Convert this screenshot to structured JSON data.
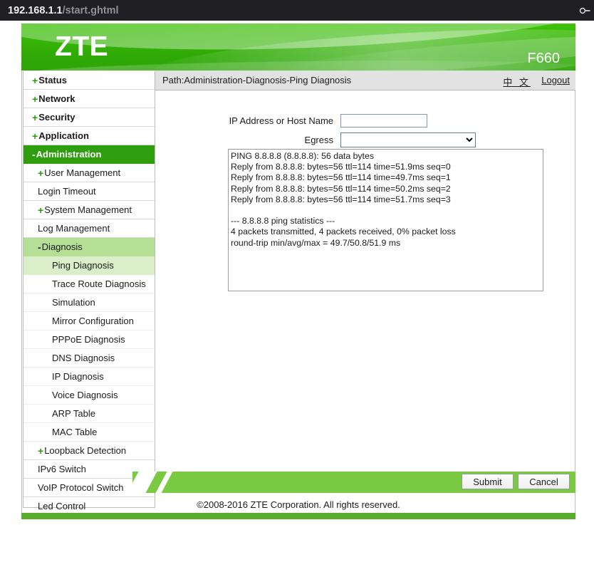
{
  "browser": {
    "url_host": "192.168.1.1",
    "url_path": "/start.ghtml",
    "titlebar_icon": "key-icon"
  },
  "header": {
    "logo": "ZTE",
    "model": "F660",
    "brand_green": "#35b307"
  },
  "pathbar": {
    "path": "Path:Administration-Diagnosis-Ping Diagnosis",
    "lang_link": "中 文",
    "logout_link": "Logout"
  },
  "sidebar": {
    "selected_color": "#2f9e0e",
    "group_color": "#b4df94",
    "active_color": "#d9eec9",
    "items": [
      {
        "label": "Status",
        "level": 1,
        "prefix": "+",
        "state": "collapsed"
      },
      {
        "label": "Network",
        "level": 1,
        "prefix": "+",
        "state": "collapsed"
      },
      {
        "label": "Security",
        "level": 1,
        "prefix": "+",
        "state": "collapsed"
      },
      {
        "label": "Application",
        "level": 1,
        "prefix": "+",
        "state": "collapsed"
      },
      {
        "label": "Administration",
        "level": 1,
        "prefix": "-",
        "state": "selected"
      },
      {
        "label": "User Management",
        "level": 2,
        "prefix": "+",
        "state": "collapsed"
      },
      {
        "label": "Login Timeout",
        "level": 2,
        "prefix": "",
        "state": "normal"
      },
      {
        "label": "System Management",
        "level": 2,
        "prefix": "+",
        "state": "collapsed"
      },
      {
        "label": "Log Management",
        "level": 2,
        "prefix": "",
        "state": "normal"
      },
      {
        "label": "Diagnosis",
        "level": 2,
        "prefix": "-",
        "state": "group-open"
      },
      {
        "label": "Ping Diagnosis",
        "level": 3,
        "prefix": "",
        "state": "active"
      },
      {
        "label": "Trace Route Diagnosis",
        "level": 3,
        "prefix": "",
        "state": "normal"
      },
      {
        "label": "Simulation",
        "level": 3,
        "prefix": "",
        "state": "normal"
      },
      {
        "label": "Mirror Configuration",
        "level": 3,
        "prefix": "",
        "state": "normal"
      },
      {
        "label": "PPPoE Diagnosis",
        "level": 3,
        "prefix": "",
        "state": "normal"
      },
      {
        "label": "DNS Diagnosis",
        "level": 3,
        "prefix": "",
        "state": "normal"
      },
      {
        "label": "IP Diagnosis",
        "level": 3,
        "prefix": "",
        "state": "normal"
      },
      {
        "label": "Voice Diagnosis",
        "level": 3,
        "prefix": "",
        "state": "normal"
      },
      {
        "label": "ARP Table",
        "level": 3,
        "prefix": "",
        "state": "normal"
      },
      {
        "label": "MAC Table",
        "level": 3,
        "prefix": "",
        "state": "normal"
      },
      {
        "label": "Loopback Detection",
        "level": 2,
        "prefix": "+",
        "state": "collapsed"
      },
      {
        "label": "IPv6 Switch",
        "level": 2,
        "prefix": "",
        "state": "normal"
      },
      {
        "label": "VoIP Protocol Switch",
        "level": 2,
        "prefix": "",
        "state": "normal"
      },
      {
        "label": "Led Control",
        "level": 2,
        "prefix": "",
        "state": "normal"
      }
    ]
  },
  "form": {
    "ip_label": "IP Address or Host Name",
    "ip_value": "",
    "ip_placeholder": "",
    "egress_label": "Egress",
    "egress_value": "",
    "egress_options": [
      ""
    ]
  },
  "ping_result": {
    "text": "PING 8.8.8.8 (8.8.8.8): 56 data bytes\nReply from 8.8.8.8: bytes=56 ttl=114 time=51.9ms seq=0\nReply from 8.8.8.8: bytes=56 ttl=114 time=49.7ms seq=1\nReply from 8.8.8.8: bytes=56 ttl=114 time=50.2ms seq=2\nReply from 8.8.8.8: bytes=56 ttl=114 time=51.7ms seq=3\n\n--- 8.8.8.8 ping statistics ---\n4 packets transmitted, 4 packets received, 0% packet loss\nround-trip min/avg/max = 49.7/50.8/51.9 ms",
    "target": "8.8.8.8",
    "data_bytes": 56,
    "replies": [
      {
        "from": "8.8.8.8",
        "bytes": 56,
        "ttl": 114,
        "time_ms": 51.9,
        "seq": 0
      },
      {
        "from": "8.8.8.8",
        "bytes": 56,
        "ttl": 114,
        "time_ms": 49.7,
        "seq": 1
      },
      {
        "from": "8.8.8.8",
        "bytes": 56,
        "ttl": 114,
        "time_ms": 50.2,
        "seq": 2
      },
      {
        "from": "8.8.8.8",
        "bytes": 56,
        "ttl": 114,
        "time_ms": 51.7,
        "seq": 3
      }
    ],
    "packets_transmitted": 4,
    "packets_received": 4,
    "packet_loss": "0%",
    "rtt_min": 49.7,
    "rtt_avg": 50.8,
    "rtt_max": 51.9
  },
  "footer": {
    "submit_label": "Submit",
    "cancel_label": "Cancel",
    "copyright": "©2008-2016 ZTE Corporation. All rights reserved.",
    "bar_color": "#7ac943"
  }
}
